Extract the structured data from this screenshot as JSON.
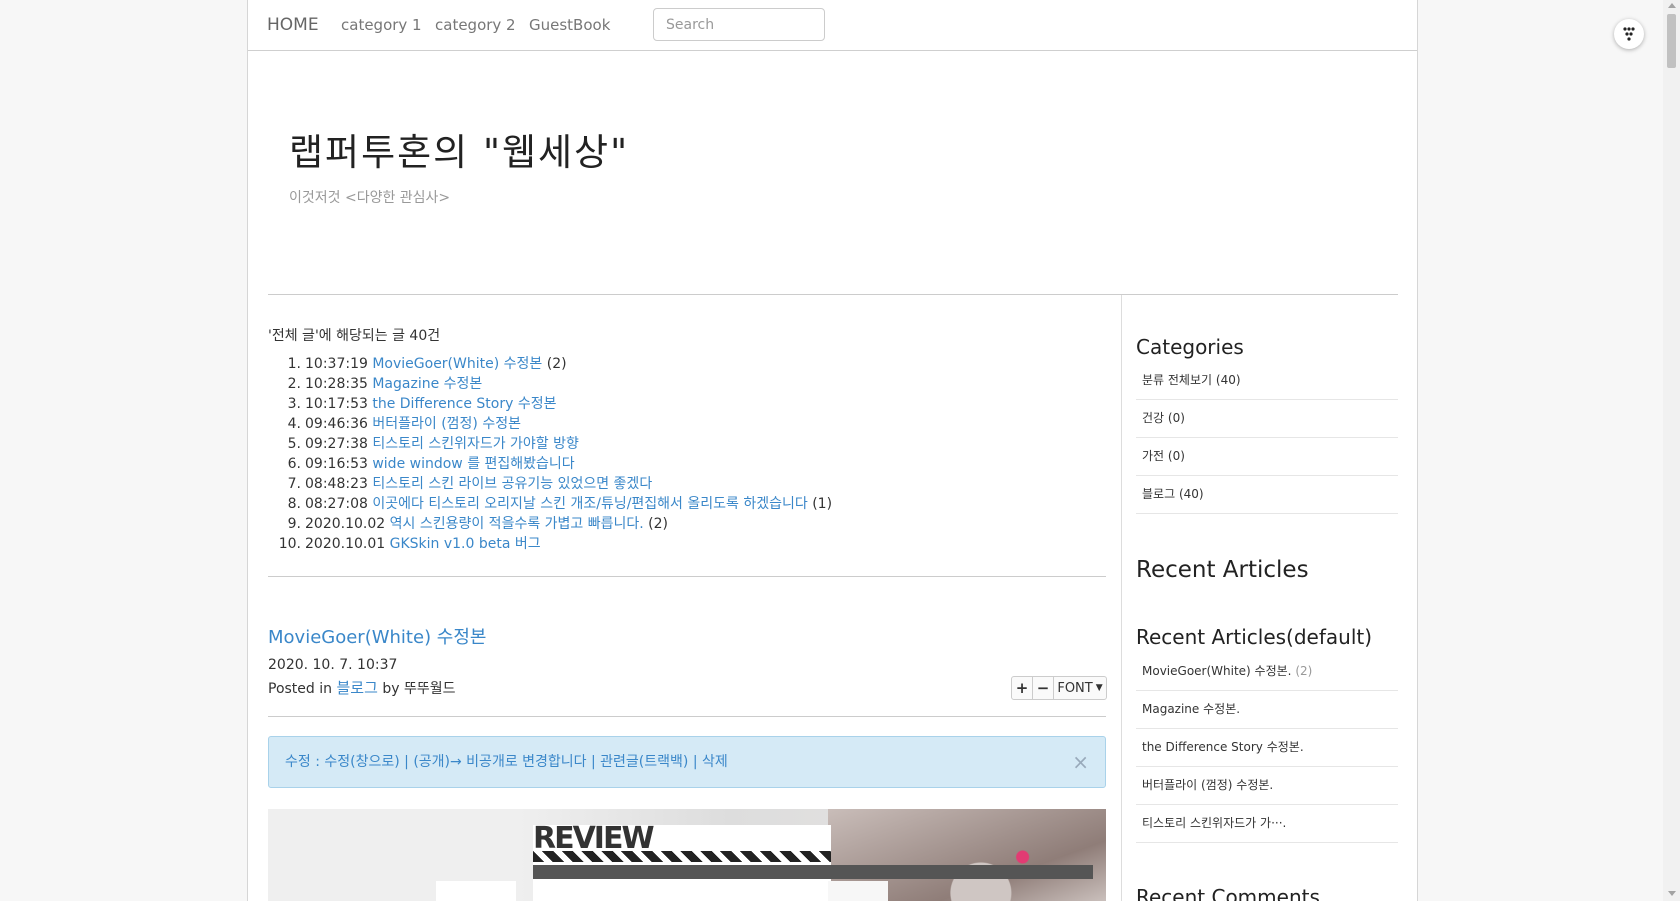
{
  "nav": {
    "home": "HOME",
    "items": [
      "category 1",
      "category 2",
      "GuestBook"
    ],
    "search_placeholder": "Search"
  },
  "blog": {
    "title": "랩퍼투혼의 \"웹세상\"",
    "description": "이것저것 <다양한 관심사>"
  },
  "post_list": {
    "header": "'전체 글'에 해당되는 글 40건",
    "items": [
      {
        "num": "1.",
        "time": "10:37:19",
        "title": "MovieGoer(White) 수정본",
        "comments": "(2)"
      },
      {
        "num": "2.",
        "time": "10:28:35",
        "title": "Magazine 수정본",
        "comments": ""
      },
      {
        "num": "3.",
        "time": "10:17:53",
        "title": "the Difference Story 수정본",
        "comments": ""
      },
      {
        "num": "4.",
        "time": "09:46:36",
        "title": "버터플라이 (껌정) 수정본",
        "comments": ""
      },
      {
        "num": "5.",
        "time": "09:27:38",
        "title": "티스토리 스킨위자드가 가야할 방향",
        "comments": ""
      },
      {
        "num": "6.",
        "time": "09:16:53",
        "title": "wide window 를 편집해봤습니다",
        "comments": ""
      },
      {
        "num": "7.",
        "time": "08:48:23",
        "title": "티스토리 스킨 라이브 공유기능 있었으면 좋겠다",
        "comments": ""
      },
      {
        "num": "8.",
        "time": "08:27:08",
        "title": "이곳에다 티스토리 오리지날 스킨 개조/튜닝/편집해서 올리도록 하겠습니다",
        "comments": "(1)"
      },
      {
        "num": "9.",
        "time": "2020.10.02",
        "title": "역시 스킨용량이 적을수록 가볍고 빠릅니다.",
        "comments": "(2)"
      },
      {
        "num": "10.",
        "time": "2020.10.01",
        "title": "GKSkin v1.0 beta 버그",
        "comments": ""
      }
    ]
  },
  "post": {
    "title": "MovieGoer(White) 수정본",
    "date": "2020. 10. 7. 10:37",
    "posted_in": "Posted in",
    "category": "블로그",
    "by": "by",
    "author": "뚜뚜월드",
    "font_label": "FONT",
    "admin_text": "수정 : 수정(창으로) | (공개)→ 비공개로 변경합니다 | 관련글(트랙백) | 삭제",
    "close": "×",
    "screenshot_text": "REVIEW"
  },
  "sidebar": {
    "categories_title": "Categories",
    "categories": [
      {
        "label": "분류 전체보기",
        "count": "(40)"
      },
      {
        "label": "건강",
        "count": "(0)"
      },
      {
        "label": "가전",
        "count": "(0)"
      },
      {
        "label": "블로그",
        "count": "(40)"
      }
    ],
    "recent_articles_title": "Recent Articles",
    "recent_default_title": "Recent Articles(default)",
    "recent_default": [
      {
        "label": "MovieGoer(White) 수정본.",
        "count": "(2)"
      },
      {
        "label": "Magazine 수정본.",
        "count": ""
      },
      {
        "label": "the Difference Story 수정본.",
        "count": ""
      },
      {
        "label": "버터플라이 (껌정) 수정본.",
        "count": ""
      },
      {
        "label": "티스토리 스킨위자드가 가···.",
        "count": ""
      }
    ],
    "recent_comments_title": "Recent Comments"
  },
  "colors": {
    "link": "#3a87c9",
    "admin_bg": "#d5eaf6"
  }
}
